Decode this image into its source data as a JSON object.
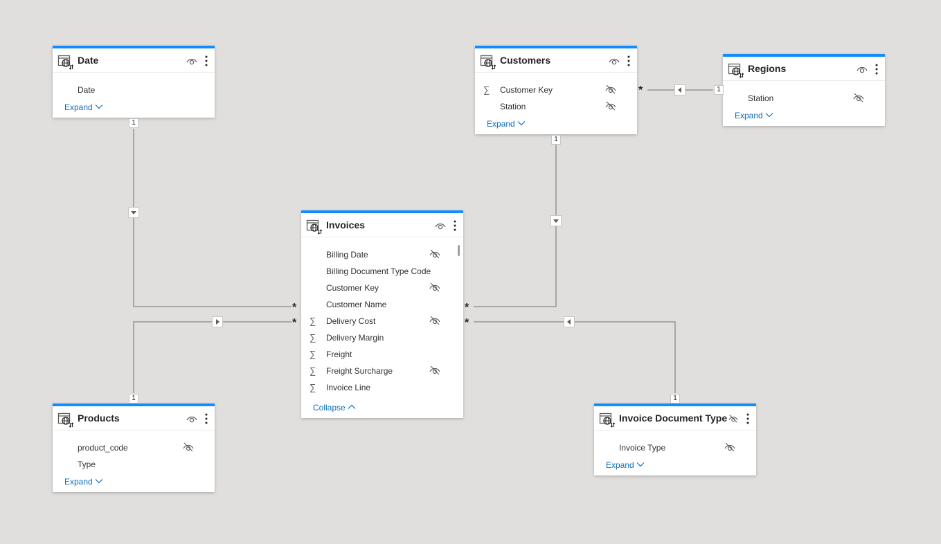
{
  "tables": {
    "date": {
      "title": "Date",
      "fields": [
        {
          "name": "Date",
          "measure": false,
          "hidden": false
        }
      ],
      "toggle": "Expand"
    },
    "customers": {
      "title": "Customers",
      "fields": [
        {
          "name": "Customer Key",
          "measure": true,
          "hidden": true
        },
        {
          "name": "Station",
          "measure": false,
          "hidden": true
        }
      ],
      "toggle": "Expand"
    },
    "regions": {
      "title": "Regions",
      "fields": [
        {
          "name": "Station",
          "measure": false,
          "hidden": true
        }
      ],
      "toggle": "Expand"
    },
    "invoices": {
      "title": "Invoices",
      "fields": [
        {
          "name": "Billing Date",
          "measure": false,
          "hidden": true
        },
        {
          "name": "Billing Document Type Code",
          "measure": false,
          "hidden": false
        },
        {
          "name": "Customer Key",
          "measure": false,
          "hidden": true
        },
        {
          "name": "Customer Name",
          "measure": false,
          "hidden": false
        },
        {
          "name": "Delivery Cost",
          "measure": true,
          "hidden": true
        },
        {
          "name": "Delivery Margin",
          "measure": true,
          "hidden": false
        },
        {
          "name": "Freight",
          "measure": true,
          "hidden": false
        },
        {
          "name": "Freight Surcharge",
          "measure": true,
          "hidden": true
        },
        {
          "name": "Invoice Line",
          "measure": true,
          "hidden": false
        }
      ],
      "toggle": "Collapse"
    },
    "products": {
      "title": "Products",
      "fields": [
        {
          "name": "product_code",
          "measure": false,
          "hidden": true
        },
        {
          "name": "Type",
          "measure": false,
          "hidden": false
        }
      ],
      "toggle": "Expand"
    },
    "invoice_doc_type": {
      "title": "Invoice Document Type",
      "fields": [
        {
          "name": "Invoice Type",
          "measure": false,
          "hidden": true
        }
      ],
      "toggle": "Expand"
    }
  },
  "cardinality": {
    "one": "1",
    "many": "*"
  },
  "colors": {
    "canvas": "#e1dfdd",
    "accent": "#118dff",
    "line": "#8a8886",
    "link": "#106ebe"
  },
  "icons": {
    "table": "table-globe-icon",
    "visible": "eye-icon",
    "hidden": "eye-hidden-icon",
    "more": "more-vertical-icon",
    "measure": "sigma-icon",
    "chevron": "chevron-icon",
    "filter-direction": "triangle-arrow-icon"
  }
}
